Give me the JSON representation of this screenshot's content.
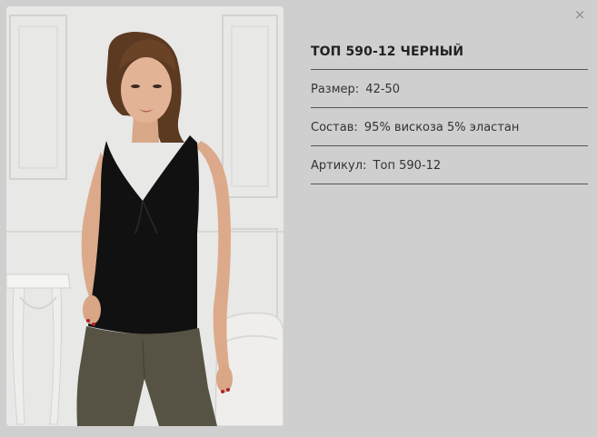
{
  "product": {
    "title": "ТОП 590-12 ЧЕРНЫЙ",
    "size_label": "Размер:",
    "size_value": "42-50",
    "composition_label": "Состав:",
    "composition_value": "95% вискоза 5% эластан",
    "sku_label": "Артикул:",
    "sku_value": "Топ 590-12"
  },
  "controls": {
    "close_glyph": "×"
  },
  "image": {
    "subject": "model wearing black v-neck top and olive trousers"
  },
  "colors": {
    "background": "#cfcfcf",
    "divider": "#555555",
    "top": "#111111",
    "trousers": "#565344"
  }
}
